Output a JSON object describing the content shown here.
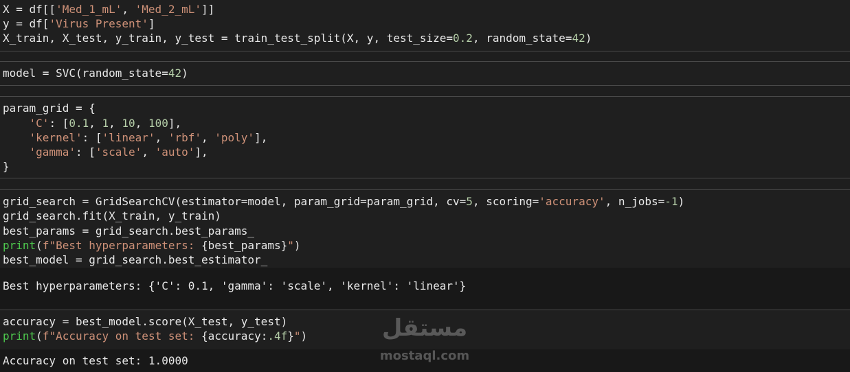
{
  "cells": {
    "c1": {
      "l1": {
        "a": "X = df[[",
        "b": "'Med_1_mL'",
        "c": ", ",
        "d": "'Med_2_mL'",
        "e": "]]"
      },
      "l2": {
        "a": "y = df[",
        "b": "'Virus Present'",
        "c": "]"
      },
      "l3": {
        "a": "X_train, X_test, y_train, y_test = train_test_split(X, y, test_size=",
        "b": "0.2",
        "c": ", random_state=",
        "d": "42",
        "e": ")"
      }
    },
    "c2": {
      "l1": {
        "a": "model = SVC(random_state=",
        "b": "42",
        "c": ")"
      }
    },
    "c3": {
      "l1": {
        "a": "param_grid = {"
      },
      "l2": {
        "pre": "    ",
        "key": "'C'",
        "a": ": [",
        "v1": "0.1",
        "s1": ", ",
        "v2": "1",
        "s2": ", ",
        "v3": "10",
        "s3": ", ",
        "v4": "100",
        "b": "],"
      },
      "l3": {
        "pre": "    ",
        "key": "'kernel'",
        "a": ": [",
        "v1": "'linear'",
        "s1": ", ",
        "v2": "'rbf'",
        "s2": ", ",
        "v3": "'poly'",
        "b": "],"
      },
      "l4": {
        "pre": "    ",
        "key": "'gamma'",
        "a": ": [",
        "v1": "'scale'",
        "s1": ", ",
        "v2": "'auto'",
        "b": "],"
      },
      "l5": {
        "a": "}"
      }
    },
    "c4": {
      "l1": {
        "a": "grid_search = GridSearchCV(estimator=model, param_grid=param_grid, cv=",
        "b": "5",
        "c": ", scoring=",
        "d": "'accuracy'",
        "e": ", n_jobs=",
        "f": "-1",
        "g": ")"
      },
      "l2": {
        "a": "grid_search.fit(X_train, y_train)"
      },
      "l3": {
        "a": "best_params = grid_search.best_params_"
      },
      "l4": {
        "kw": "print",
        "a": "(",
        "s": "f\"Best hyperparameters: ",
        "b": "{best_params}",
        "s2": "\"",
        "c": ")"
      },
      "l5": {
        "a": "best_model = grid_search.best_estimator_"
      }
    },
    "o4": {
      "text": "Best hyperparameters: {'C': 0.1, 'gamma': 'scale', 'kernel': 'linear'}"
    },
    "c5": {
      "l1": {
        "a": "accuracy = best_model.score(X_test, y_test)"
      },
      "l2": {
        "kw": "print",
        "a": "(",
        "s": "f\"Accuracy on test set: ",
        "b": "{accuracy:",
        "n": ".4f",
        "b2": "}",
        "s2": "\"",
        "c": ")"
      }
    },
    "o5": {
      "text": "Accuracy on test set: 1.0000"
    }
  },
  "watermark": {
    "word": "مستقل",
    "url": "mostaql.com"
  },
  "colors": {
    "string": "#ce9178",
    "number": "#b5cea8",
    "keyword": "#4ec94e",
    "background": "#1e1e1e"
  }
}
